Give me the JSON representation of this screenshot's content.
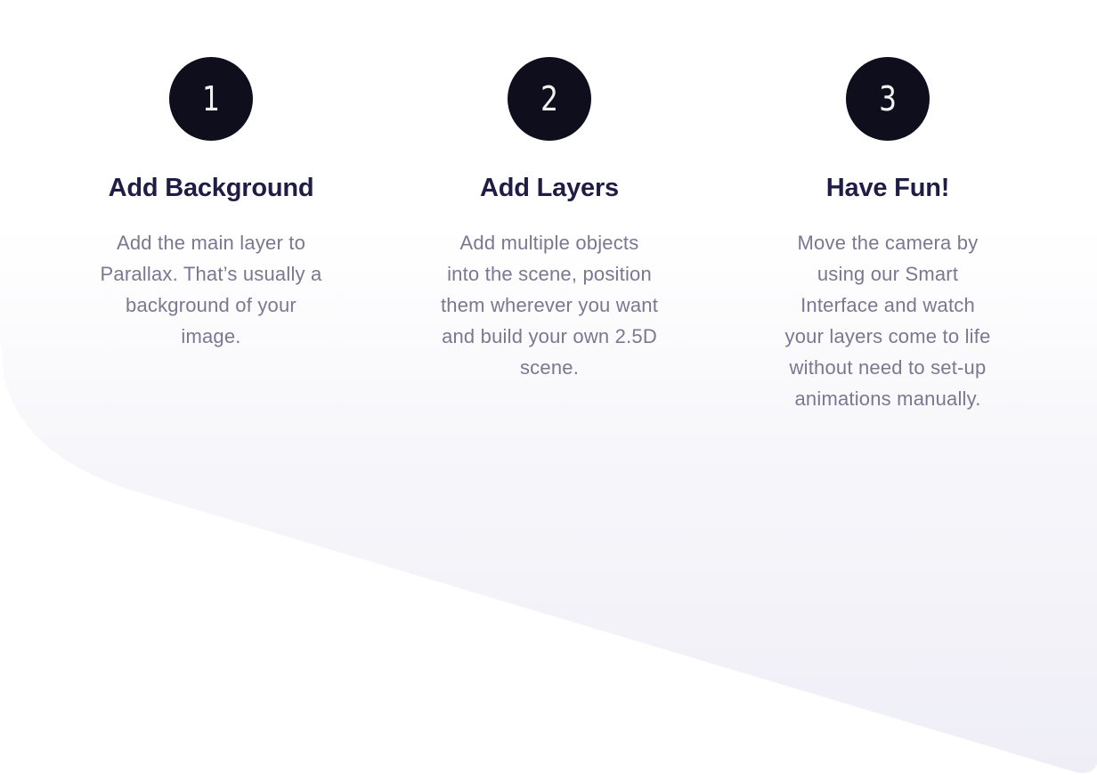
{
  "colors": {
    "circle_fill": "#0f0e1c",
    "circle_text": "#ffffff",
    "title": "#201d45",
    "description": "#7a7891",
    "background_shape": "#f2f1f8"
  },
  "steps": [
    {
      "number": "1",
      "title": "Add Background",
      "description_lines": [
        "Add the main layer to",
        "Parallax. That’s usually a",
        "background of your",
        "image."
      ]
    },
    {
      "number": "2",
      "title": "Add Layers",
      "description_lines": [
        "Add multiple objects",
        "into the scene, position",
        "them wherever you want",
        "and build your own 2.5D",
        "scene."
      ]
    },
    {
      "number": "3",
      "title": "Have Fun!",
      "description_lines": [
        "Move the camera by",
        "using our Smart",
        "Interface and watch",
        "your layers come to life",
        "without need to set-up",
        "animations manually."
      ]
    }
  ]
}
